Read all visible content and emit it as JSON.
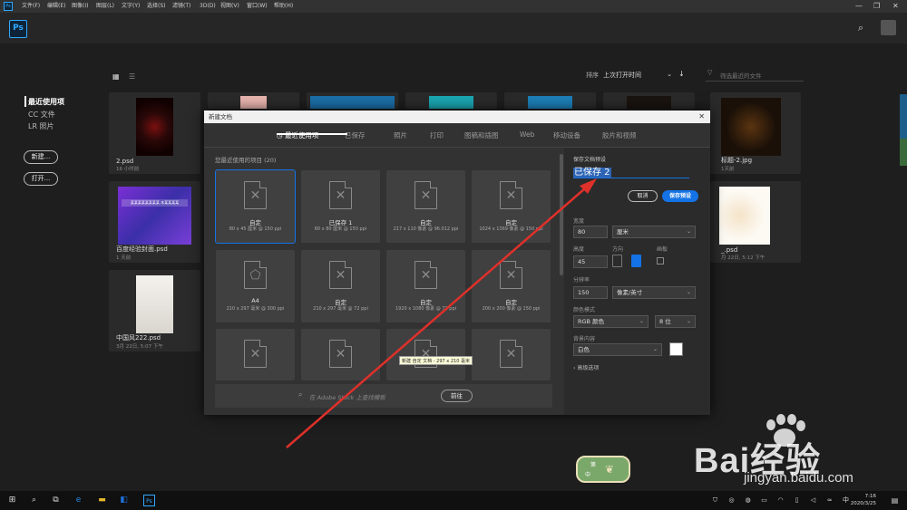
{
  "menubar": {
    "items": [
      "文件(F)",
      "编辑(E)",
      "图像(I)",
      "图层(L)",
      "文字(Y)",
      "选择(S)",
      "滤镜(T)",
      "3D(D)",
      "视图(V)",
      "窗口(W)",
      "帮助(H)"
    ]
  },
  "app": {
    "logo": "Ps"
  },
  "home": {
    "sort_label": "排序",
    "sort_value": "上次打开时间",
    "filter_placeholder": "筛选最近的文件",
    "sidebar": [
      "最近使用项",
      "CC 文件",
      "LR 照片"
    ],
    "new_button": "新建...",
    "open_button": "打开...",
    "files": [
      {
        "name": "2.psd",
        "meta": "16 小时前"
      },
      {
        "name": "百度经验封面.psd",
        "meta": "1 天前",
        "thumb_text": "某某某某某某某某 本某某某某"
      },
      {
        "name": "中国风222.psd",
        "meta": "3月 22日, 5:07 下午"
      },
      {
        "name": "标题-2.jpg",
        "meta": "1天前"
      },
      {
        "name": "_.psd",
        "meta": "月 22日, 5:12 下午"
      }
    ]
  },
  "dialog": {
    "title": "新建文档",
    "tabs": [
      "最近使用项",
      "已保存",
      "照片",
      "打印",
      "图稿和插图",
      "Web",
      "移动设备",
      "胶片和视频"
    ],
    "recent_header": "您最近使用的项目 (20)",
    "presets": [
      {
        "label": "自定",
        "meta": "80 x 45 厘米 @ 150 ppi"
      },
      {
        "label": "已保存 1",
        "meta": "60 x 80 厘米 @ 150 ppi"
      },
      {
        "label": "自定",
        "meta": "217 x 110 像素 @ 96.012 ppi"
      },
      {
        "label": "自定",
        "meta": "1024 x 1369 像素 @ 150 ppi"
      },
      {
        "label": "A4",
        "meta": "210 x 297 毫米 @ 300 ppi"
      },
      {
        "label": "自定",
        "meta": "210 x 297 毫米 @ 72 ppi"
      },
      {
        "label": "自定",
        "meta": "1920 x 1080 像素 @ 72 ppi"
      },
      {
        "label": "自定",
        "meta": "200 x 200 像素 @ 150 ppi"
      },
      {
        "label": "",
        "meta": ""
      },
      {
        "label": "",
        "meta": ""
      },
      {
        "label": "",
        "meta": ""
      },
      {
        "label": "",
        "meta": ""
      }
    ],
    "tooltip": "新建 自定 文档 - 297 x 210 毫米",
    "search_placeholder": "在 Adobe Stock 上查找模板",
    "go_button": "前往"
  },
  "details": {
    "section_title": "保存文档预设",
    "preset_name": "已保存 2",
    "cancel": "取消",
    "save": "保存预设",
    "width_label": "宽度",
    "width_value": "80",
    "width_unit": "厘米",
    "height_label": "高度",
    "height_value": "45",
    "orientation_label": "方向",
    "artboard_label": "画板",
    "resolution_label": "分辨率",
    "resolution_value": "150",
    "resolution_unit": "像素/英寸",
    "color_mode_label": "颜色模式",
    "color_mode_value": "RGB 颜色",
    "bit_depth": "8 位",
    "background_label": "背景内容",
    "background_value": "白色",
    "advanced": "高级选项"
  },
  "taskbar": {
    "time": "7:16",
    "date": "2020/3/25",
    "ime": "中"
  },
  "watermark": {
    "brand": "Bai经验",
    "url": "jingyan.baidu.com"
  },
  "badge": {
    "line1": "第",
    "line2": "中"
  }
}
